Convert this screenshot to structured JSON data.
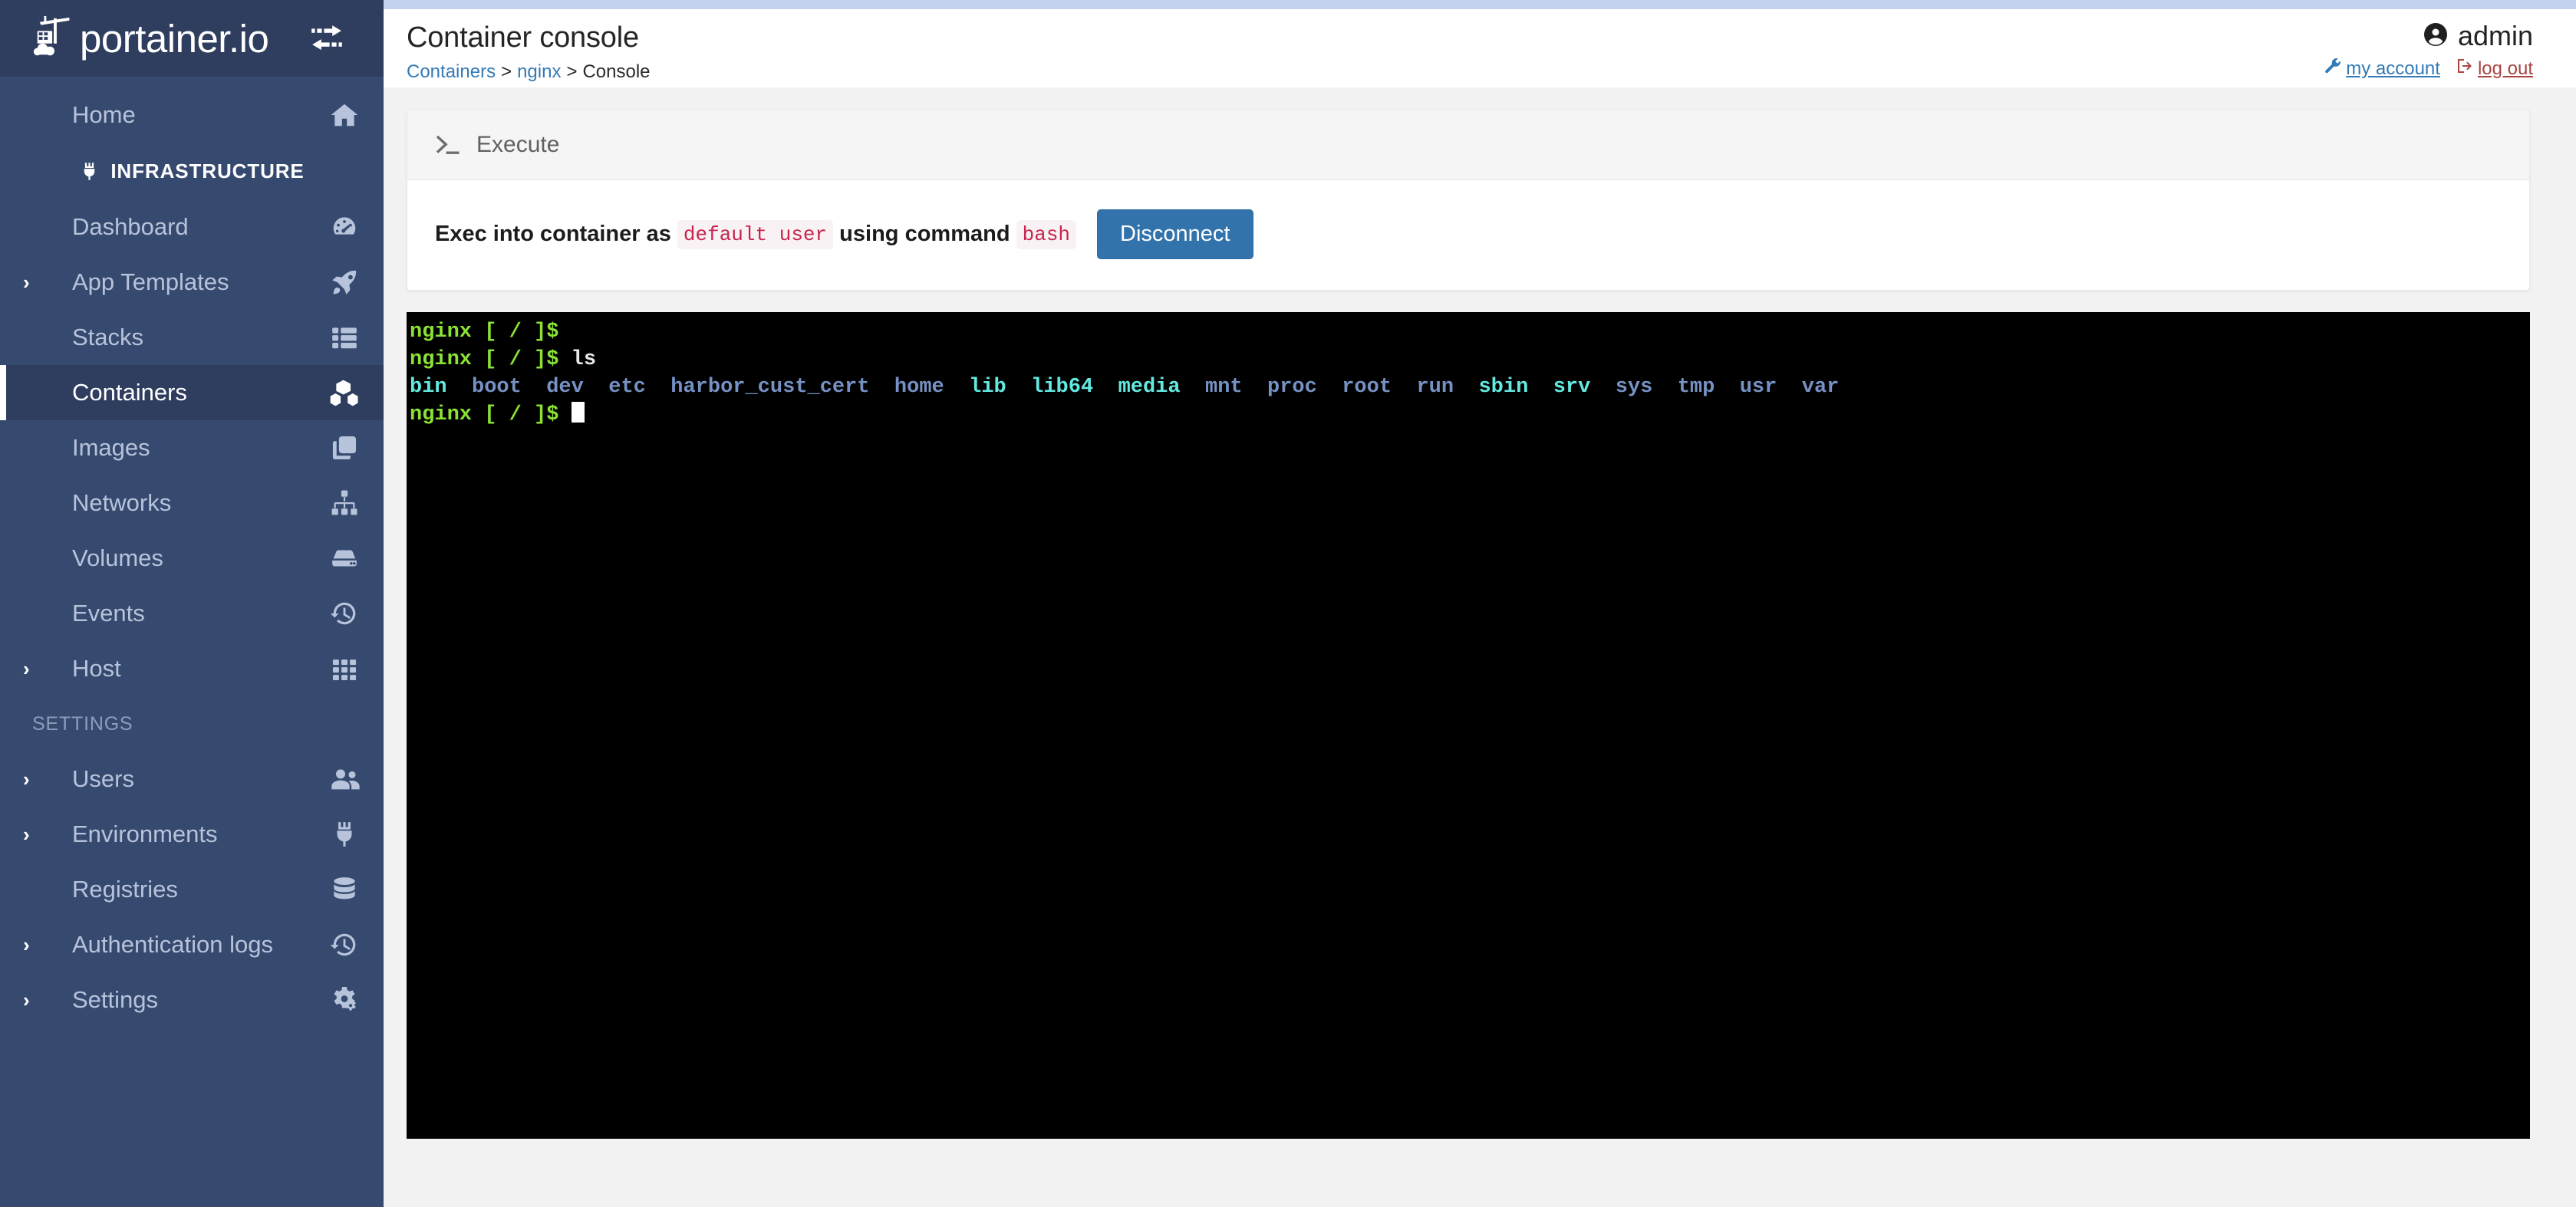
{
  "brand": {
    "name": "portainer.io",
    "toggle_icon": "sidebar-toggle-icon"
  },
  "sidebar": {
    "home": {
      "label": "Home",
      "icon": "home-icon"
    },
    "section_infrastructure": {
      "label": "INFRASTRUCTURE",
      "icon": "plug-icon"
    },
    "section_settings": {
      "label": "SETTINGS"
    },
    "infrastructure_items": [
      {
        "label": "Dashboard",
        "icon": "dashboard-icon",
        "expandable": false,
        "active": false
      },
      {
        "label": "App Templates",
        "icon": "rocket-icon",
        "expandable": true,
        "active": false
      },
      {
        "label": "Stacks",
        "icon": "stacks-icon",
        "expandable": false,
        "active": false
      },
      {
        "label": "Containers",
        "icon": "containers-icon",
        "expandable": false,
        "active": true
      },
      {
        "label": "Images",
        "icon": "images-icon",
        "expandable": false,
        "active": false
      },
      {
        "label": "Networks",
        "icon": "networks-icon",
        "expandable": false,
        "active": false
      },
      {
        "label": "Volumes",
        "icon": "volumes-icon",
        "expandable": false,
        "active": false
      },
      {
        "label": "Events",
        "icon": "history-icon",
        "expandable": false,
        "active": false
      },
      {
        "label": "Host",
        "icon": "grid-icon",
        "expandable": true,
        "active": false
      }
    ],
    "settings_items": [
      {
        "label": "Users",
        "icon": "users-icon",
        "expandable": true,
        "active": false
      },
      {
        "label": "Environments",
        "icon": "plug-icon",
        "expandable": true,
        "active": false
      },
      {
        "label": "Registries",
        "icon": "database-icon",
        "expandable": false,
        "active": false
      },
      {
        "label": "Authentication logs",
        "icon": "history-icon",
        "expandable": true,
        "active": false
      },
      {
        "label": "Settings",
        "icon": "gears-icon",
        "expandable": true,
        "active": false
      }
    ]
  },
  "header": {
    "title": "Container console",
    "breadcrumb": {
      "root": "Containers",
      "sep1": ">",
      "container": "nginx",
      "sep2": ">",
      "current": "Console"
    },
    "user": {
      "name": "admin",
      "avatar_icon": "user-circle-icon",
      "account_link": "my account",
      "account_icon": "wrench-icon",
      "logout_link": "log out",
      "logout_icon": "logout-icon"
    }
  },
  "execute_panel": {
    "header_title": "Execute",
    "header_icon": "terminal-prompt-icon",
    "text_before_user": "Exec into container as ",
    "user_value": "default user",
    "text_between": " using command ",
    "command_value": "bash",
    "disconnect_label": "Disconnect"
  },
  "terminal": {
    "prompt": "nginx [ / ]$",
    "lines": [
      {
        "type": "prompt",
        "prompt": "nginx [ / ]$",
        "command": ""
      },
      {
        "type": "prompt",
        "prompt": "nginx [ / ]$",
        "command": " ls"
      },
      {
        "type": "output",
        "entries": [
          {
            "name": "bin",
            "kind": "symlink"
          },
          {
            "name": "boot",
            "kind": "dir"
          },
          {
            "name": "dev",
            "kind": "dir"
          },
          {
            "name": "etc",
            "kind": "dir"
          },
          {
            "name": "harbor_cust_cert",
            "kind": "dir"
          },
          {
            "name": "home",
            "kind": "dir"
          },
          {
            "name": "lib",
            "kind": "symlink"
          },
          {
            "name": "lib64",
            "kind": "symlink"
          },
          {
            "name": "media",
            "kind": "symlink"
          },
          {
            "name": "mnt",
            "kind": "dir"
          },
          {
            "name": "proc",
            "kind": "dir"
          },
          {
            "name": "root",
            "kind": "dir"
          },
          {
            "name": "run",
            "kind": "dir"
          },
          {
            "name": "sbin",
            "kind": "symlink"
          },
          {
            "name": "srv",
            "kind": "symlink"
          },
          {
            "name": "sys",
            "kind": "dir"
          },
          {
            "name": "tmp",
            "kind": "dir"
          },
          {
            "name": "usr",
            "kind": "dir"
          },
          {
            "name": "var",
            "kind": "dir"
          }
        ]
      },
      {
        "type": "prompt_cursor",
        "prompt": "nginx [ / ]$",
        "command": " "
      }
    ],
    "colors": {
      "background": "#000000",
      "prompt": "#8ae234",
      "command": "#e8e8e8",
      "dir": "#7691c4",
      "symlink": "#63e9e0",
      "cursor": "#ffffff"
    }
  },
  "theme": {
    "sidebar_bg": "#364a70",
    "sidebar_logo_bg": "#2f3e5e",
    "accent_blue": "#337ab7",
    "button_blue": "#3273ac",
    "danger_red": "#a94442",
    "code_red": "#c7254e",
    "top_accent": "#c2d2ef",
    "page_bg": "#f2f2f2"
  }
}
